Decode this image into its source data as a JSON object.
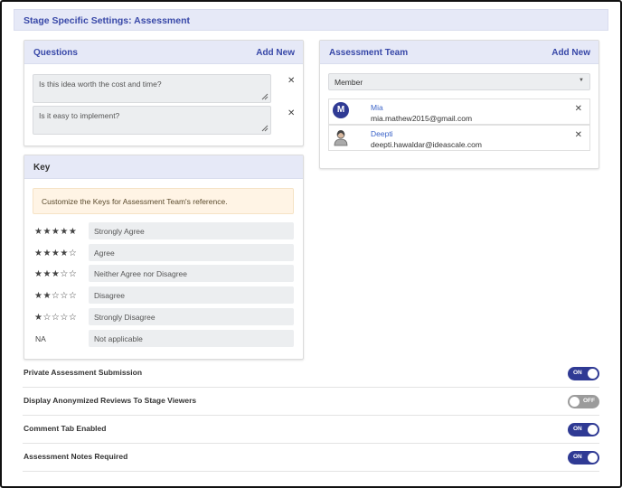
{
  "page": {
    "title": "Stage Specific Settings: Assessment"
  },
  "questions": {
    "title": "Questions",
    "add_new": "Add New",
    "items": [
      {
        "value": "Is this idea worth the cost and time?"
      },
      {
        "value": "Is it easy to implement?"
      }
    ],
    "remove_icon": "close-icon"
  },
  "key": {
    "title": "Key",
    "notice": "Customize the Keys for Assessment Team's reference.",
    "rows": [
      {
        "rating": "★★★★★",
        "label": "Strongly Agree"
      },
      {
        "rating": "★★★★☆",
        "label": "Agree"
      },
      {
        "rating": "★★★☆☆",
        "label": "Neither Agree nor Disagree"
      },
      {
        "rating": "★★☆☆☆",
        "label": "Disagree"
      },
      {
        "rating": "★☆☆☆☆",
        "label": "Strongly Disagree"
      },
      {
        "rating": "NA",
        "label": "Not applicable"
      }
    ]
  },
  "team": {
    "title": "Assessment Team",
    "add_new": "Add New",
    "role_select": "Member",
    "members": [
      {
        "initial": "M",
        "name": "Mia",
        "email": "mia.mathew2015@gmail.com"
      },
      {
        "initial": "",
        "name": "Deepti",
        "email": "deepti.hawaldar@ideascale.com"
      }
    ]
  },
  "settings": [
    {
      "label": "Private Assessment Submission",
      "state": "ON"
    },
    {
      "label": "Display Anonymized Reviews To Stage Viewers",
      "state": "OFF"
    },
    {
      "label": "Comment Tab Enabled",
      "state": "ON"
    },
    {
      "label": "Assessment Notes Required",
      "state": "ON"
    }
  ],
  "colors": {
    "accent": "#2f3a94",
    "header_bg": "#e6e9f7",
    "notice_bg": "#fff4e5",
    "toggle_off": "#9b9b9b"
  }
}
